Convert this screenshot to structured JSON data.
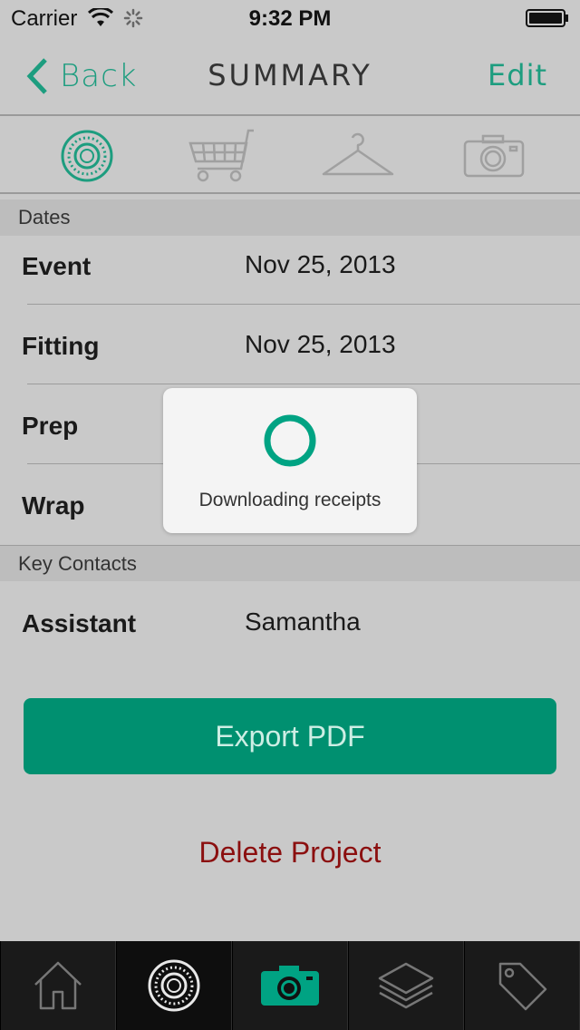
{
  "status_bar": {
    "carrier": "Carrier",
    "time": "9:32 PM"
  },
  "nav": {
    "back_label": "Back",
    "title": "SUMMARY",
    "edit_label": "Edit"
  },
  "segments": [
    {
      "icon": "dial-icon",
      "active": true
    },
    {
      "icon": "cart-icon",
      "active": false
    },
    {
      "icon": "hanger-icon",
      "active": false
    },
    {
      "icon": "camera-icon",
      "active": false
    }
  ],
  "sections": {
    "dates": {
      "header": "Dates",
      "rows": [
        {
          "label": "Event",
          "value": "Nov 25, 2013"
        },
        {
          "label": "Fitting",
          "value": "Nov 25, 2013"
        },
        {
          "label": "Prep",
          "value": ""
        },
        {
          "label": "Wrap",
          "value": ""
        }
      ]
    },
    "key_contacts": {
      "header": "Key Contacts",
      "rows": [
        {
          "label": "Assistant",
          "value": "Samantha"
        }
      ]
    }
  },
  "actions": {
    "export_label": "Export PDF",
    "delete_label": "Delete Project"
  },
  "hud": {
    "message": "Downloading receipts"
  },
  "tab_bar": [
    {
      "icon": "home-icon",
      "active": false
    },
    {
      "icon": "dial-icon",
      "active": true
    },
    {
      "icon": "camera-icon",
      "active": false
    },
    {
      "icon": "layers-icon",
      "active": false
    },
    {
      "icon": "tag-icon",
      "active": false
    }
  ],
  "colors": {
    "accent": "#1d9d7f",
    "button": "#009070",
    "danger": "#8b0f0f",
    "background": "#c9c9c9"
  }
}
